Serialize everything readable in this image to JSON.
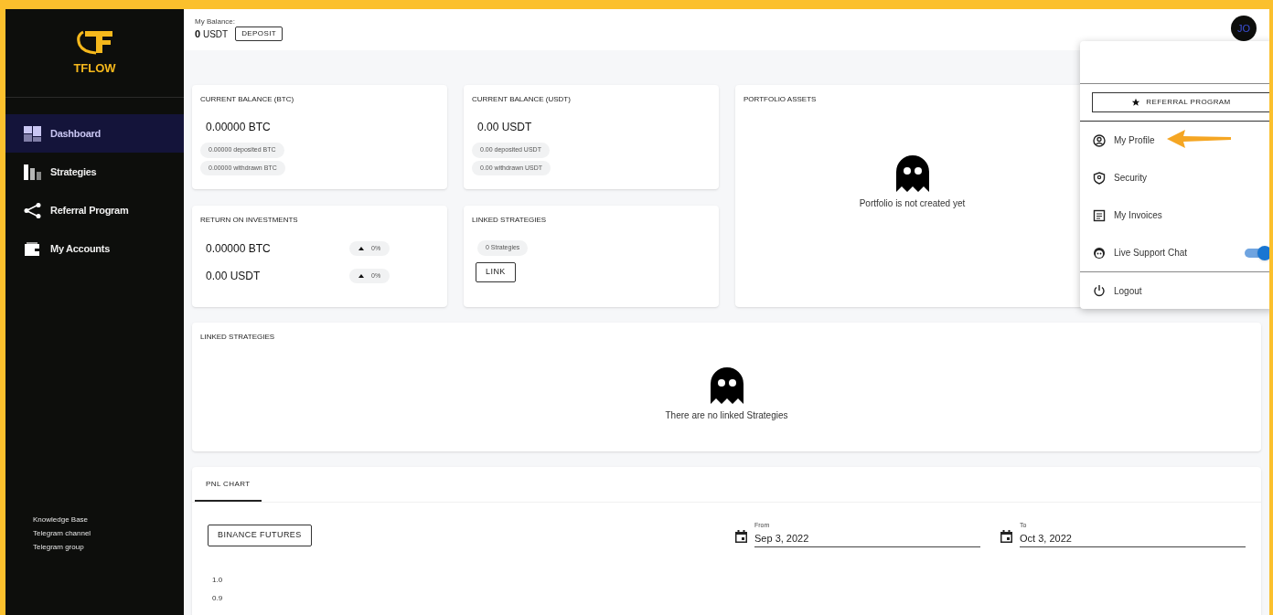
{
  "sidebar": {
    "logo_text": "TFLOW",
    "nav": [
      {
        "label": "Dashboard",
        "selected": true
      },
      {
        "label": "Strategies",
        "selected": false
      },
      {
        "label": "Referral Program",
        "selected": false
      },
      {
        "label": "My Accounts",
        "selected": false
      }
    ],
    "footer_links": [
      "Knowledge Base",
      "Telegram channel",
      "Telegram group"
    ]
  },
  "header": {
    "balance_label": "My Balance:",
    "balance_value": "0",
    "balance_unit": "USDT",
    "deposit_button": "DEPOSIT",
    "avatar": "JO"
  },
  "balance_cards": [
    {
      "title": "CURRENT BALANCE (BTC)",
      "amount": "0.00000 BTC",
      "chips": [
        "0.00000 deposited BTC",
        "0.00000 withdrawn BTC"
      ]
    },
    {
      "title": "CURRENT BALANCE (USDT)",
      "amount": "0.00 USDT",
      "chips": [
        "0.00 deposited USDT",
        "0.00 withdrawn USDT"
      ]
    }
  ],
  "portfolio": {
    "title": "PORTFOLIO ASSETS",
    "empty_text": "Portfolio is not created yet"
  },
  "roi": {
    "title": "RETURN ON INVESTMENTS",
    "rows": [
      {
        "amount": "0.00000 BTC",
        "change": "0%"
      },
      {
        "amount": "0.00 USDT",
        "change": "0%"
      }
    ]
  },
  "linked_summary": {
    "title": "LINKED STRATEGIES",
    "count": "0 Strategies",
    "link_button": "LINK"
  },
  "linked_list": {
    "title": "LINKED STRATEGIES",
    "empty_text": "There are no linked Strategies"
  },
  "pnl": {
    "tabs": [
      {
        "label": "PNL CHART",
        "selected": true
      }
    ],
    "exchange_button": "BINANCE FUTURES",
    "from": {
      "label": "From",
      "value": "Sep 3, 2022"
    },
    "to": {
      "label": "To",
      "value": "Oct 3, 2022"
    },
    "y_ticks": [
      "1.0",
      "0.9"
    ]
  },
  "user_menu": {
    "referral_button": "REFERRAL PROGRAM",
    "items": [
      {
        "label": "My Profile",
        "kind": "link"
      },
      {
        "label": "Security",
        "kind": "link"
      },
      {
        "label": "My Invoices",
        "kind": "link"
      },
      {
        "label": "Live Support Chat",
        "kind": "toggle",
        "on": true
      },
      {
        "label": "Logout",
        "kind": "link"
      }
    ]
  }
}
